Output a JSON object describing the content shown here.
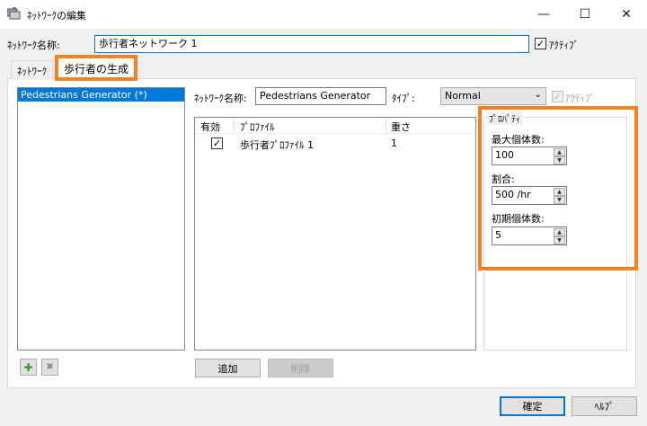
{
  "window": {
    "title": "ﾈｯﾄﾜｰｸの編集",
    "minimize": "—",
    "maximize": "☐",
    "close": "✕"
  },
  "header": {
    "network_name_label": "ﾈｯﾄﾜｰｸ名称:",
    "network_name_value": "歩行者ネットワーク 1",
    "active_label": "ｱｸﾃｨﾌﾞ",
    "active_checked": "✓"
  },
  "tabs": [
    {
      "label": "ﾈｯﾄﾜｰｸ"
    },
    {
      "label": "歩行者の生成"
    }
  ],
  "generators": {
    "items": [
      {
        "label": "Pedestrians Generator (*)"
      }
    ],
    "add_icon": "✚",
    "delete_icon": "✖"
  },
  "detail": {
    "name_label": "ﾈｯﾄﾜｰｸ名称:",
    "name_value": "Pedestrians Generator",
    "type_label": "ﾀｲﾌﾟ:",
    "type_value": "Normal",
    "active_label": "ｱｸﾃｨﾌﾞ",
    "active_checked": "✓"
  },
  "profiles": {
    "columns": [
      "有効",
      "ﾌﾟﾛﾌｧｲﾙ",
      "重さ"
    ],
    "rows": [
      {
        "enabled": "✓",
        "profile": "歩行者ﾌﾟﾛﾌｧｲﾙ 1",
        "weight": "1"
      }
    ],
    "add_button": "追加",
    "delete_button": "削除"
  },
  "properties": {
    "group_label": "ﾌﾟﾛﾊﾟﾃｨ",
    "max_label": "最大個体数:",
    "max_value": "100",
    "rate_label": "割合:",
    "rate_value": "500 /hr",
    "initial_label": "初期個体数:",
    "initial_value": "5"
  },
  "footer": {
    "ok_button": "確定",
    "help_button": "ﾍﾙﾌﾟ"
  },
  "colors": {
    "highlight": "#f58220",
    "selection": "#0078d7"
  }
}
